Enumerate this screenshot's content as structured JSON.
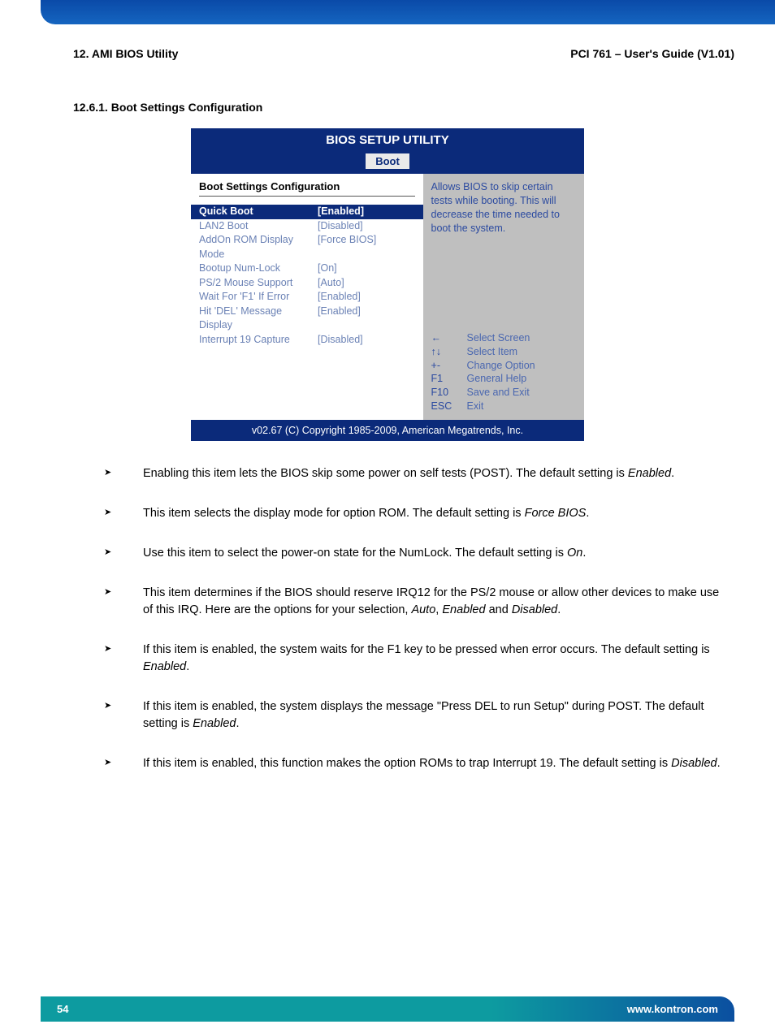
{
  "header": {
    "left": "12. AMI BIOS Utility",
    "right": "PCI 761 – User's Guide (V1.01)"
  },
  "section_title": "12.6.1. Boot Settings Configuration",
  "bios": {
    "title": "BIOS SETUP UTILITY",
    "tab": "Boot",
    "panel_title": "Boot Settings Configuration",
    "rows": [
      {
        "label": "Quick Boot",
        "value": "[Enabled]",
        "hl": true
      },
      {
        "label": "LAN2 Boot",
        "value": "[Disabled]"
      },
      {
        "label": "AddOn ROM Display Mode",
        "value": "[Force BIOS]"
      },
      {
        "label": "Bootup Num-Lock",
        "value": "[On]"
      },
      {
        "label": "PS/2 Mouse Support",
        "value": "[Auto]"
      },
      {
        "label": "Wait For 'F1' If Error",
        "value": "[Enabled]"
      },
      {
        "label": "Hit 'DEL' Message Display",
        "value": "[Enabled]"
      },
      {
        "label": "Interrupt 19 Capture",
        "value": "[Disabled]"
      }
    ],
    "help_text": "Allows BIOS to skip certain tests while booting. This will decrease the time needed to boot the system.",
    "keys": [
      {
        "k": "←",
        "t": "Select Screen"
      },
      {
        "k": "↑↓",
        "t": "Select Item"
      },
      {
        "k": "+-",
        "t": "Change Option"
      },
      {
        "k": "F1",
        "t": "General Help"
      },
      {
        "k": "F10",
        "t": "Save and Exit"
      },
      {
        "k": "ESC",
        "t": "Exit"
      }
    ],
    "footer": "v02.67 (C) Copyright 1985-2009, American Megatrends, Inc."
  },
  "bullets": [
    {
      "pre": "Enabling this item lets the BIOS skip some power on self tests (POST). The default setting is ",
      "em": "Enabled",
      "post": "."
    },
    {
      "pre": "This item selects the display mode for option ROM. The default setting is ",
      "em": "Force BIOS",
      "post": "."
    },
    {
      "pre": "Use this item to select the power-on state for the NumLock. The default setting is ",
      "em": "On",
      "post": "."
    },
    {
      "pre": "This item determines if the BIOS should reserve IRQ12 for the PS/2 mouse or allow other devices to make use of this IRQ. Here are the options for your selection, ",
      "em": "Auto",
      "post_mid": ", ",
      "em2": "Enabled",
      "post_mid2": " and ",
      "em3": "Disabled",
      "post": "."
    },
    {
      "pre": "If this item is enabled, the system waits for the F1 key to be pressed when error occurs. The default setting is ",
      "em": "Enabled",
      "post": "."
    },
    {
      "pre": "If this item is enabled, the system displays the message \"Press DEL to run Setup\" during POST. The default setting is ",
      "em": "Enabled",
      "post": "."
    },
    {
      "pre": "If this item is enabled, this function makes the option ROMs to trap Interrupt 19. The default setting is ",
      "em": "Disabled",
      "post": "."
    }
  ],
  "footer": {
    "page": "54",
    "url": "www.kontron.com"
  }
}
